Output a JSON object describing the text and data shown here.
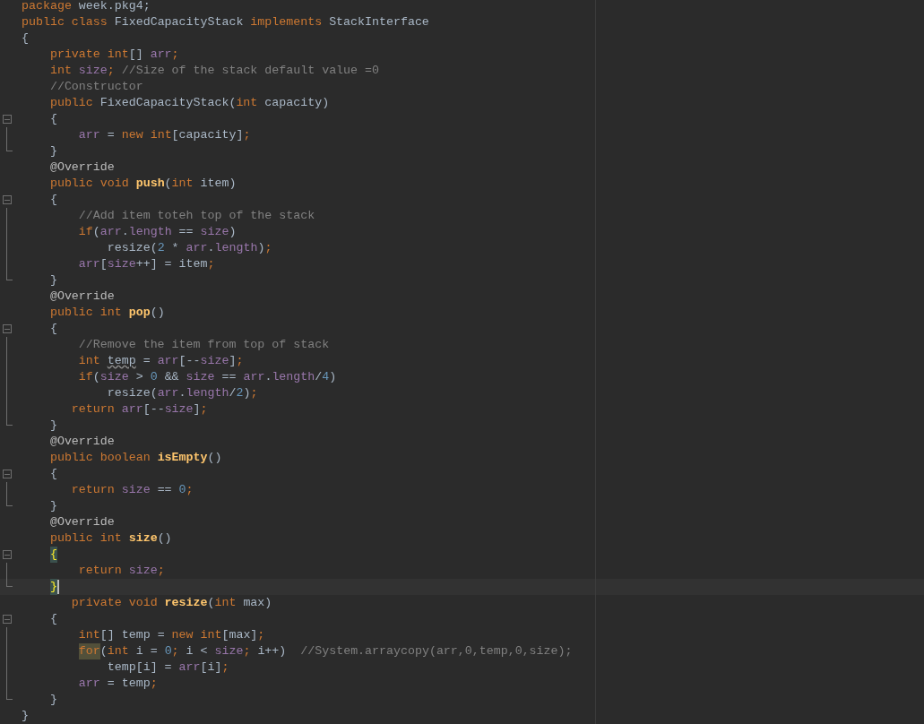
{
  "editor": {
    "lines": [
      {
        "kind": "plain",
        "tokens": [
          {
            "text": "package",
            "kind": "keyword"
          },
          {
            "text": " week.pkg4;",
            "kind": "plain"
          }
        ]
      },
      {
        "kind": "plain",
        "tokens": [
          {
            "text": "public class",
            "kind": "keyword"
          },
          {
            "text": " FixedCapacityStack ",
            "kind": "plain"
          },
          {
            "text": "implements",
            "kind": "keyword"
          },
          {
            "text": " StackInterface",
            "kind": "plain"
          }
        ]
      },
      {
        "kind": "plain",
        "tokens": [
          {
            "text": "{",
            "kind": "plain"
          }
        ]
      },
      {
        "kind": "plain",
        "tokens": [
          {
            "text": "    private int",
            "kind": "keyword"
          },
          {
            "text": "[] ",
            "kind": "plain"
          },
          {
            "text": "arr",
            "kind": "field"
          },
          {
            "text": ";",
            "kind": "keyword"
          }
        ]
      },
      {
        "kind": "plain",
        "tokens": [
          {
            "text": "    int ",
            "kind": "keyword"
          },
          {
            "text": "size",
            "kind": "field"
          },
          {
            "text": "; ",
            "kind": "keyword"
          },
          {
            "text": "//Size of the stack default value =0",
            "kind": "comment"
          }
        ]
      },
      {
        "kind": "plain",
        "tokens": [
          {
            "text": "    //Constructor",
            "kind": "comment"
          }
        ]
      },
      {
        "kind": "plain",
        "tokens": [
          {
            "text": "    public ",
            "kind": "keyword"
          },
          {
            "text": "FixedCapacityStack(",
            "kind": "plain"
          },
          {
            "text": "int ",
            "kind": "keyword"
          },
          {
            "text": "capacity)",
            "kind": "plain"
          }
        ]
      },
      {
        "kind": "fold_start",
        "tokens": [
          {
            "text": "    {",
            "kind": "plain"
          }
        ]
      },
      {
        "kind": "fold_body",
        "tokens": [
          {
            "text": "        arr",
            "kind": "field"
          },
          {
            "text": " = ",
            "kind": "plain"
          },
          {
            "text": "new int",
            "kind": "keyword"
          },
          {
            "text": "[capacity]",
            "kind": "plain"
          },
          {
            "text": ";",
            "kind": "keyword"
          }
        ]
      },
      {
        "kind": "fold_end",
        "tokens": [
          {
            "text": "    }",
            "kind": "plain"
          }
        ]
      },
      {
        "kind": "plain",
        "tokens": [
          {
            "text": "    @Override",
            "kind": "annotation"
          }
        ]
      },
      {
        "kind": "plain",
        "tokens": [
          {
            "text": "    public void ",
            "kind": "keyword"
          },
          {
            "text": "push",
            "kind": "method"
          },
          {
            "text": "(",
            "kind": "plain"
          },
          {
            "text": "int ",
            "kind": "keyword"
          },
          {
            "text": "item)",
            "kind": "plain"
          }
        ]
      },
      {
        "kind": "fold_start",
        "tokens": [
          {
            "text": "    {",
            "kind": "plain"
          }
        ]
      },
      {
        "kind": "fold_body",
        "tokens": [
          {
            "text": "        //Add item toteh top of the stack",
            "kind": "comment"
          }
        ]
      },
      {
        "kind": "fold_body",
        "tokens": [
          {
            "text": "        if",
            "kind": "keyword"
          },
          {
            "text": "(",
            "kind": "plain"
          },
          {
            "text": "arr",
            "kind": "field"
          },
          {
            "text": ".",
            "kind": "plain"
          },
          {
            "text": "length",
            "kind": "field"
          },
          {
            "text": " == ",
            "kind": "plain"
          },
          {
            "text": "size",
            "kind": "field"
          },
          {
            "text": ")",
            "kind": "plain"
          }
        ]
      },
      {
        "kind": "fold_body",
        "tokens": [
          {
            "text": "            resize(",
            "kind": "plain"
          },
          {
            "text": "2",
            "kind": "number"
          },
          {
            "text": " * ",
            "kind": "plain"
          },
          {
            "text": "arr",
            "kind": "field"
          },
          {
            "text": ".",
            "kind": "plain"
          },
          {
            "text": "length",
            "kind": "field"
          },
          {
            "text": ")",
            "kind": "plain"
          },
          {
            "text": ";",
            "kind": "keyword"
          }
        ]
      },
      {
        "kind": "fold_body",
        "tokens": [
          {
            "text": "        arr",
            "kind": "field"
          },
          {
            "text": "[",
            "kind": "plain"
          },
          {
            "text": "size",
            "kind": "field"
          },
          {
            "text": "++] = item",
            "kind": "plain"
          },
          {
            "text": ";",
            "kind": "keyword"
          }
        ]
      },
      {
        "kind": "fold_end",
        "tokens": [
          {
            "text": "    }",
            "kind": "plain"
          }
        ]
      },
      {
        "kind": "plain",
        "tokens": [
          {
            "text": "    @Override",
            "kind": "annotation"
          }
        ]
      },
      {
        "kind": "plain",
        "tokens": [
          {
            "text": "    public int ",
            "kind": "keyword"
          },
          {
            "text": "pop",
            "kind": "method"
          },
          {
            "text": "()",
            "kind": "plain"
          }
        ]
      },
      {
        "kind": "fold_start",
        "tokens": [
          {
            "text": "    {",
            "kind": "plain"
          }
        ]
      },
      {
        "kind": "fold_body",
        "tokens": [
          {
            "text": "        //Remove the item from top of stack",
            "kind": "comment"
          }
        ]
      },
      {
        "kind": "fold_body",
        "tokens": [
          {
            "text": "        int ",
            "kind": "keyword"
          },
          {
            "text": "temp",
            "kind": "plain",
            "warning": true
          },
          {
            "text": " = ",
            "kind": "plain"
          },
          {
            "text": "arr",
            "kind": "field"
          },
          {
            "text": "[--",
            "kind": "plain"
          },
          {
            "text": "size",
            "kind": "field"
          },
          {
            "text": "]",
            "kind": "plain"
          },
          {
            "text": ";",
            "kind": "keyword"
          }
        ]
      },
      {
        "kind": "fold_body",
        "tokens": [
          {
            "text": "        if",
            "kind": "keyword"
          },
          {
            "text": "(",
            "kind": "plain"
          },
          {
            "text": "size",
            "kind": "field"
          },
          {
            "text": " > ",
            "kind": "plain"
          },
          {
            "text": "0",
            "kind": "number"
          },
          {
            "text": " && ",
            "kind": "plain"
          },
          {
            "text": "size",
            "kind": "field"
          },
          {
            "text": " == ",
            "kind": "plain"
          },
          {
            "text": "arr",
            "kind": "field"
          },
          {
            "text": ".",
            "kind": "plain"
          },
          {
            "text": "length",
            "kind": "field"
          },
          {
            "text": "/",
            "kind": "plain"
          },
          {
            "text": "4",
            "kind": "number"
          },
          {
            "text": ")",
            "kind": "plain"
          }
        ]
      },
      {
        "kind": "fold_body",
        "tokens": [
          {
            "text": "            resize(",
            "kind": "plain"
          },
          {
            "text": "arr",
            "kind": "field"
          },
          {
            "text": ".",
            "kind": "plain"
          },
          {
            "text": "length",
            "kind": "field"
          },
          {
            "text": "/",
            "kind": "plain"
          },
          {
            "text": "2",
            "kind": "number"
          },
          {
            "text": ")",
            "kind": "plain"
          },
          {
            "text": ";",
            "kind": "keyword"
          }
        ]
      },
      {
        "kind": "fold_body",
        "tokens": [
          {
            "text": "       return ",
            "kind": "keyword"
          },
          {
            "text": "arr",
            "kind": "field"
          },
          {
            "text": "[--",
            "kind": "plain"
          },
          {
            "text": "size",
            "kind": "field"
          },
          {
            "text": "]",
            "kind": "plain"
          },
          {
            "text": ";",
            "kind": "keyword"
          }
        ]
      },
      {
        "kind": "fold_end",
        "tokens": [
          {
            "text": "    }",
            "kind": "plain"
          }
        ]
      },
      {
        "kind": "plain",
        "tokens": [
          {
            "text": "    @Override",
            "kind": "annotation"
          }
        ]
      },
      {
        "kind": "plain",
        "tokens": [
          {
            "text": "    public boolean ",
            "kind": "keyword"
          },
          {
            "text": "isEmpty",
            "kind": "method"
          },
          {
            "text": "()",
            "kind": "plain"
          }
        ]
      },
      {
        "kind": "fold_start",
        "tokens": [
          {
            "text": "    {",
            "kind": "plain"
          }
        ]
      },
      {
        "kind": "fold_body",
        "tokens": [
          {
            "text": "       return ",
            "kind": "keyword"
          },
          {
            "text": "size",
            "kind": "field"
          },
          {
            "text": " == ",
            "kind": "plain"
          },
          {
            "text": "0",
            "kind": "number"
          },
          {
            "text": ";",
            "kind": "keyword"
          }
        ]
      },
      {
        "kind": "fold_end",
        "tokens": [
          {
            "text": "    }",
            "kind": "plain"
          }
        ]
      },
      {
        "kind": "plain",
        "tokens": [
          {
            "text": "    @Override",
            "kind": "annotation"
          }
        ]
      },
      {
        "kind": "plain",
        "tokens": [
          {
            "text": "    public int ",
            "kind": "keyword"
          },
          {
            "text": "size",
            "kind": "method"
          },
          {
            "text": "()",
            "kind": "plain"
          }
        ]
      },
      {
        "kind": "fold_start",
        "tokens": [
          {
            "text": "    {",
            "kind": "plain",
            "matched": true
          }
        ]
      },
      {
        "kind": "fold_body",
        "tokens": [
          {
            "text": "        return ",
            "kind": "keyword"
          },
          {
            "text": "size",
            "kind": "field"
          },
          {
            "text": ";",
            "kind": "keyword"
          }
        ]
      },
      {
        "kind": "fold_end",
        "current": true,
        "tokens": [
          {
            "text": "    }",
            "kind": "plain",
            "matched": true
          }
        ]
      },
      {
        "kind": "plain",
        "tokens": [
          {
            "text": "       private void ",
            "kind": "keyword"
          },
          {
            "text": "resize",
            "kind": "method"
          },
          {
            "text": "(",
            "kind": "plain"
          },
          {
            "text": "int ",
            "kind": "keyword"
          },
          {
            "text": "max)",
            "kind": "plain"
          }
        ]
      },
      {
        "kind": "fold_start",
        "tokens": [
          {
            "text": "    {",
            "kind": "plain"
          }
        ]
      },
      {
        "kind": "fold_body",
        "tokens": [
          {
            "text": "        int",
            "kind": "keyword"
          },
          {
            "text": "[] temp = ",
            "kind": "plain"
          },
          {
            "text": "new int",
            "kind": "keyword"
          },
          {
            "text": "[max]",
            "kind": "plain"
          },
          {
            "text": ";",
            "kind": "keyword"
          }
        ]
      },
      {
        "kind": "fold_body",
        "tokens": [
          {
            "text": "        for",
            "kind": "keyword",
            "usage": true
          },
          {
            "text": "(",
            "kind": "plain"
          },
          {
            "text": "int ",
            "kind": "keyword"
          },
          {
            "text": "i = ",
            "kind": "plain"
          },
          {
            "text": "0",
            "kind": "number"
          },
          {
            "text": "; ",
            "kind": "keyword"
          },
          {
            "text": "i < ",
            "kind": "plain"
          },
          {
            "text": "size",
            "kind": "field"
          },
          {
            "text": "; ",
            "kind": "keyword"
          },
          {
            "text": "i++)  ",
            "kind": "plain"
          },
          {
            "text": "//System.arraycopy(arr,0,temp,0,size);",
            "kind": "comment"
          }
        ]
      },
      {
        "kind": "fold_body",
        "tokens": [
          {
            "text": "            temp[i] = ",
            "kind": "plain"
          },
          {
            "text": "arr",
            "kind": "field"
          },
          {
            "text": "[i]",
            "kind": "plain"
          },
          {
            "text": ";",
            "kind": "keyword"
          }
        ]
      },
      {
        "kind": "fold_body",
        "tokens": [
          {
            "text": "        arr",
            "kind": "field"
          },
          {
            "text": " = temp",
            "kind": "plain"
          },
          {
            "text": ";",
            "kind": "keyword"
          }
        ]
      },
      {
        "kind": "fold_end",
        "tokens": [
          {
            "text": "    }",
            "kind": "plain"
          }
        ]
      },
      {
        "kind": "plain",
        "tokens": [
          {
            "text": "}",
            "kind": "plain"
          }
        ]
      }
    ]
  }
}
